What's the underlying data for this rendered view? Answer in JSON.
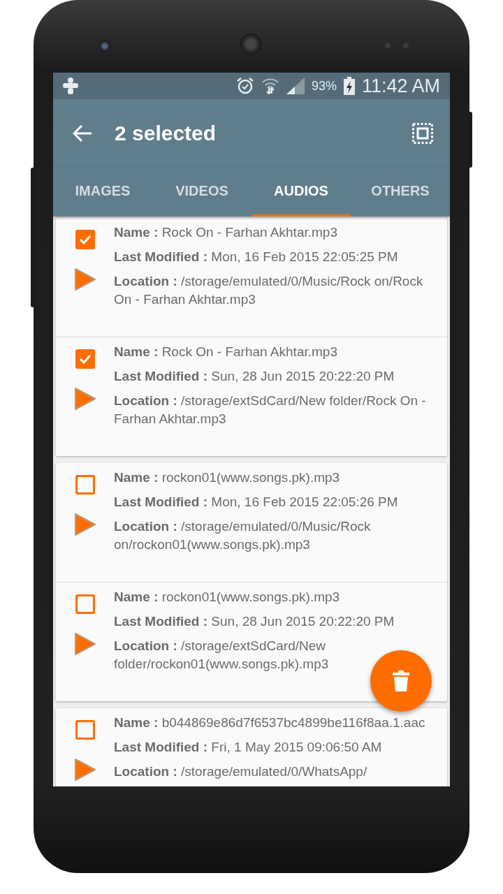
{
  "status_bar": {
    "battery": "93%",
    "time": "11:42 AM"
  },
  "toolbar": {
    "title": "2 selected"
  },
  "tabs": [
    {
      "label": "IMAGES",
      "selected": false
    },
    {
      "label": "VIDEOS",
      "selected": false
    },
    {
      "label": "AUDIOS",
      "selected": true
    },
    {
      "label": "OTHERS",
      "selected": false
    }
  ],
  "groups": [
    {
      "files": [
        {
          "checked": true,
          "fields": [
            {
              "label": "Name :",
              "value": "Rock On - Farhan Akhtar.mp3"
            },
            {
              "label": "Last Modified :",
              "value": "Mon, 16 Feb 2015 22:05:25 PM"
            },
            {
              "label": "Location :",
              "value": "/storage/emulated/0/Music/Rock on/Rock On - Farhan Akhtar.mp3"
            }
          ]
        },
        {
          "checked": true,
          "fields": [
            {
              "label": "Name :",
              "value": "Rock On - Farhan Akhtar.mp3"
            },
            {
              "label": "Last Modified :",
              "value": "Sun, 28 Jun 2015 20:22:20 PM"
            },
            {
              "label": "Location :",
              "value": "/storage/extSdCard/New folder/Rock On - Farhan Akhtar.mp3"
            }
          ]
        }
      ]
    },
    {
      "files": [
        {
          "checked": false,
          "fields": [
            {
              "label": "Name :",
              "value": "rockon01(www.songs.pk).mp3"
            },
            {
              "label": "Last Modified :",
              "value": "Mon, 16 Feb 2015 22:05:26 PM"
            },
            {
              "label": "Location :",
              "value": "/storage/emulated/0/Music/Rock on/rockon01(www.songs.pk).mp3"
            }
          ]
        },
        {
          "checked": false,
          "fields": [
            {
              "label": "Name :",
              "value": "rockon01(www.songs.pk).mp3"
            },
            {
              "label": "Last Modified :",
              "value": "Sun, 28 Jun 2015 20:22:20 PM"
            },
            {
              "label": "Location :",
              "value": "/storage/extSdCard/New folder/rockon01(www.songs.pk).mp3"
            }
          ]
        }
      ]
    },
    {
      "files": [
        {
          "checked": false,
          "fields": [
            {
              "label": "Name :",
              "value": "b044869e86d7f6537bc4899be116f8aa.1.aac"
            },
            {
              "label": "Last Modified :",
              "value": "Fri, 1 May 2015 09:06:50 AM"
            },
            {
              "label": "Location :",
              "value": "/storage/emulated/0/WhatsApp/"
            }
          ]
        }
      ]
    }
  ]
}
